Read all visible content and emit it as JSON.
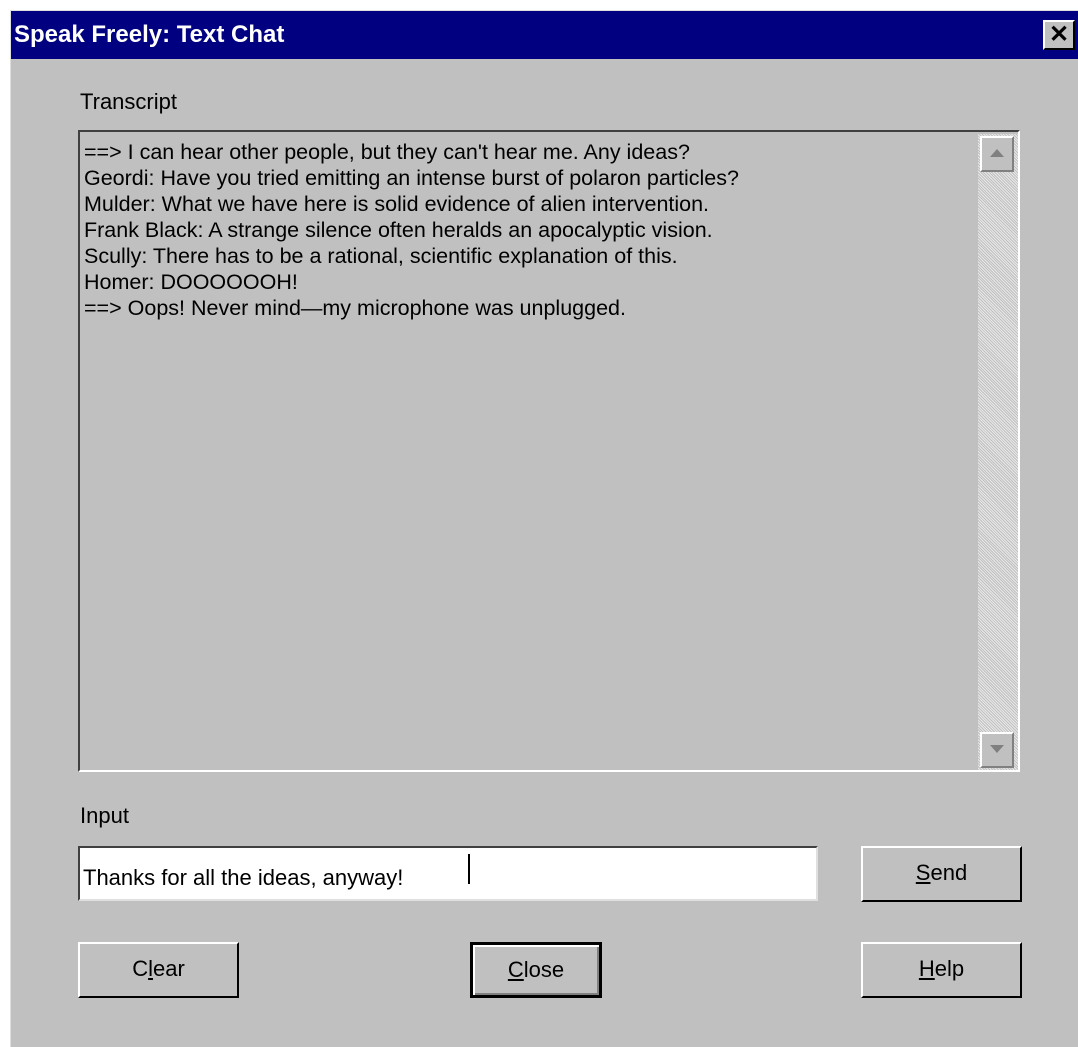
{
  "window": {
    "title": "Speak Freely: Text Chat",
    "close_glyph": "✕"
  },
  "transcript": {
    "label": "Transcript",
    "lines": [
      "==> I can hear other people, but they can't hear me.  Any ideas?",
      "Geordi: Have you tried emitting an intense burst of polaron particles?",
      "Mulder: What we have here is solid evidence of alien intervention.",
      "Frank Black: A strange silence often heralds an apocalyptic vision.",
      "Scully: There has to be a rational, scientific explanation of this.",
      "Homer: DOOOOOOH!",
      "==> Oops!  Never mind—my microphone was unplugged."
    ],
    "scroll_up_icon": "triangle-up",
    "scroll_down_icon": "triangle-down"
  },
  "input": {
    "label": "Input",
    "value": "Thanks for all the ideas, anyway!"
  },
  "buttons": {
    "send": {
      "mnemonic": "S",
      "rest": "end"
    },
    "clear": {
      "pre": "C",
      "mnemonic": "l",
      "rest": "ear"
    },
    "close": {
      "mnemonic": "C",
      "rest": "lose"
    },
    "help": {
      "mnemonic": "H",
      "rest": "elp"
    }
  },
  "colors": {
    "titlebar": "#000080",
    "dialog": "#c0c0c0"
  }
}
